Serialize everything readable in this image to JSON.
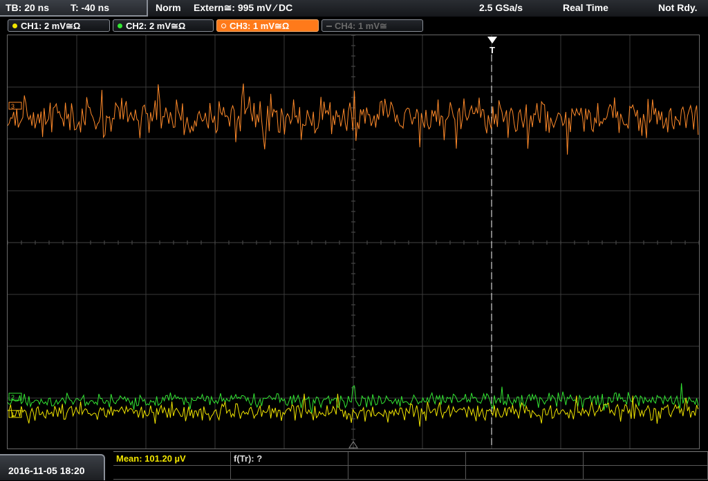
{
  "statusbar": {
    "timebase": "TB: 20 ns",
    "trigger_pos": "T: -40 ns",
    "trigger_mode": "Norm",
    "trigger_source": "Extern≅: 995 mV ⁄ DC",
    "sample_rate": "2.5 GSa/s",
    "acq_mode": "Real Time",
    "state": "Not Rdy."
  },
  "channels": [
    {
      "label": "CH1: 2 mV≅Ω",
      "color": "#f2e600",
      "active": true
    },
    {
      "label": "CH2: 2 mV≅Ω",
      "color": "#33e633",
      "active": true
    },
    {
      "label": "CH3: 1 mV≅Ω",
      "color": "#ff8a2a",
      "active": true,
      "selected": true
    },
    {
      "label": "CH4: 1 mV≅",
      "color": "#707070",
      "active": false
    }
  ],
  "trigger_marker": "T",
  "measurements": {
    "mean": "Mean: 101.20 µV",
    "freq": "f(Tr): ?"
  },
  "datetime": "2016-11-05 18:20",
  "colors": {
    "ch1": "#f2e600",
    "ch2": "#33e633",
    "ch3": "#ff8a2a",
    "grid": "#3a3a3a",
    "trigger": "#ffffff"
  }
}
